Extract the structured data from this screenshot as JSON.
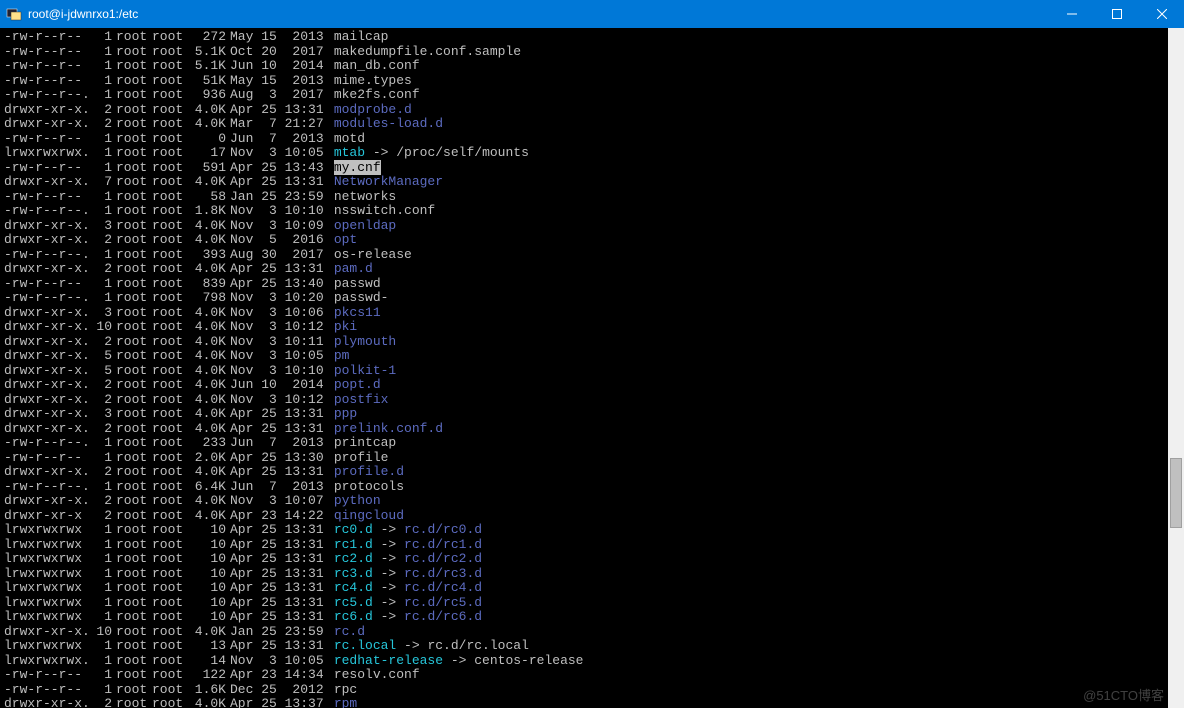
{
  "window": {
    "title": "root@i-jdwnrxo1:/etc"
  },
  "watermark": "@51CTO博客",
  "listing": [
    {
      "perm": "-rw-r--r--",
      "nl": "1",
      "own": "root",
      "grp": "root",
      "sz": "272",
      "date": "May 15  2013",
      "name": "mailcap",
      "type": "file"
    },
    {
      "perm": "-rw-r--r--",
      "nl": "1",
      "own": "root",
      "grp": "root",
      "sz": "5.1K",
      "date": "Oct 20  2017",
      "name": "makedumpfile.conf.sample",
      "type": "file"
    },
    {
      "perm": "-rw-r--r--",
      "nl": "1",
      "own": "root",
      "grp": "root",
      "sz": "5.1K",
      "date": "Jun 10  2014",
      "name": "man_db.conf",
      "type": "file"
    },
    {
      "perm": "-rw-r--r--",
      "nl": "1",
      "own": "root",
      "grp": "root",
      "sz": "51K",
      "date": "May 15  2013",
      "name": "mime.types",
      "type": "file"
    },
    {
      "perm": "-rw-r--r--.",
      "nl": "1",
      "own": "root",
      "grp": "root",
      "sz": "936",
      "date": "Aug  3  2017",
      "name": "mke2fs.conf",
      "type": "file"
    },
    {
      "perm": "drwxr-xr-x.",
      "nl": "2",
      "own": "root",
      "grp": "root",
      "sz": "4.0K",
      "date": "Apr 25 13:31",
      "name": "modprobe.d",
      "type": "dir"
    },
    {
      "perm": "drwxr-xr-x.",
      "nl": "2",
      "own": "root",
      "grp": "root",
      "sz": "4.0K",
      "date": "Mar  7 21:27",
      "name": "modules-load.d",
      "type": "dir"
    },
    {
      "perm": "-rw-r--r--",
      "nl": "1",
      "own": "root",
      "grp": "root",
      "sz": "0",
      "date": "Jun  7  2013",
      "name": "motd",
      "type": "file"
    },
    {
      "perm": "lrwxrwxrwx.",
      "nl": "1",
      "own": "root",
      "grp": "root",
      "sz": "17",
      "date": "Nov  3 10:05",
      "name": "mtab",
      "type": "link",
      "target": "/proc/self/mounts",
      "target_type": "plain"
    },
    {
      "perm": "-rw-r--r--",
      "nl": "1",
      "own": "root",
      "grp": "root",
      "sz": "591",
      "date": "Apr 25 13:43",
      "name": "my.cnf",
      "type": "highlight"
    },
    {
      "perm": "drwxr-xr-x.",
      "nl": "7",
      "own": "root",
      "grp": "root",
      "sz": "4.0K",
      "date": "Apr 25 13:31",
      "name": "NetworkManager",
      "type": "dir"
    },
    {
      "perm": "-rw-r--r--",
      "nl": "1",
      "own": "root",
      "grp": "root",
      "sz": "58",
      "date": "Jan 25 23:59",
      "name": "networks",
      "type": "file"
    },
    {
      "perm": "-rw-r--r--.",
      "nl": "1",
      "own": "root",
      "grp": "root",
      "sz": "1.8K",
      "date": "Nov  3 10:10",
      "name": "nsswitch.conf",
      "type": "file"
    },
    {
      "perm": "drwxr-xr-x.",
      "nl": "3",
      "own": "root",
      "grp": "root",
      "sz": "4.0K",
      "date": "Nov  3 10:09",
      "name": "openldap",
      "type": "dir"
    },
    {
      "perm": "drwxr-xr-x.",
      "nl": "2",
      "own": "root",
      "grp": "root",
      "sz": "4.0K",
      "date": "Nov  5  2016",
      "name": "opt",
      "type": "dir"
    },
    {
      "perm": "-rw-r--r--.",
      "nl": "1",
      "own": "root",
      "grp": "root",
      "sz": "393",
      "date": "Aug 30  2017",
      "name": "os-release",
      "type": "file"
    },
    {
      "perm": "drwxr-xr-x.",
      "nl": "2",
      "own": "root",
      "grp": "root",
      "sz": "4.0K",
      "date": "Apr 25 13:31",
      "name": "pam.d",
      "type": "dir"
    },
    {
      "perm": "-rw-r--r--",
      "nl": "1",
      "own": "root",
      "grp": "root",
      "sz": "839",
      "date": "Apr 25 13:40",
      "name": "passwd",
      "type": "file"
    },
    {
      "perm": "-rw-r--r--.",
      "nl": "1",
      "own": "root",
      "grp": "root",
      "sz": "798",
      "date": "Nov  3 10:20",
      "name": "passwd-",
      "type": "file"
    },
    {
      "perm": "drwxr-xr-x.",
      "nl": "3",
      "own": "root",
      "grp": "root",
      "sz": "4.0K",
      "date": "Nov  3 10:06",
      "name": "pkcs11",
      "type": "dir"
    },
    {
      "perm": "drwxr-xr-x.",
      "nl": "10",
      "own": "root",
      "grp": "root",
      "sz": "4.0K",
      "date": "Nov  3 10:12",
      "name": "pki",
      "type": "dir"
    },
    {
      "perm": "drwxr-xr-x.",
      "nl": "2",
      "own": "root",
      "grp": "root",
      "sz": "4.0K",
      "date": "Nov  3 10:11",
      "name": "plymouth",
      "type": "dir"
    },
    {
      "perm": "drwxr-xr-x.",
      "nl": "5",
      "own": "root",
      "grp": "root",
      "sz": "4.0K",
      "date": "Nov  3 10:05",
      "name": "pm",
      "type": "dir"
    },
    {
      "perm": "drwxr-xr-x.",
      "nl": "5",
      "own": "root",
      "grp": "root",
      "sz": "4.0K",
      "date": "Nov  3 10:10",
      "name": "polkit-1",
      "type": "dir"
    },
    {
      "perm": "drwxr-xr-x.",
      "nl": "2",
      "own": "root",
      "grp": "root",
      "sz": "4.0K",
      "date": "Jun 10  2014",
      "name": "popt.d",
      "type": "dir"
    },
    {
      "perm": "drwxr-xr-x.",
      "nl": "2",
      "own": "root",
      "grp": "root",
      "sz": "4.0K",
      "date": "Nov  3 10:12",
      "name": "postfix",
      "type": "dir"
    },
    {
      "perm": "drwxr-xr-x.",
      "nl": "3",
      "own": "root",
      "grp": "root",
      "sz": "4.0K",
      "date": "Apr 25 13:31",
      "name": "ppp",
      "type": "dir"
    },
    {
      "perm": "drwxr-xr-x.",
      "nl": "2",
      "own": "root",
      "grp": "root",
      "sz": "4.0K",
      "date": "Apr 25 13:31",
      "name": "prelink.conf.d",
      "type": "dir"
    },
    {
      "perm": "-rw-r--r--.",
      "nl": "1",
      "own": "root",
      "grp": "root",
      "sz": "233",
      "date": "Jun  7  2013",
      "name": "printcap",
      "type": "file"
    },
    {
      "perm": "-rw-r--r--",
      "nl": "1",
      "own": "root",
      "grp": "root",
      "sz": "2.0K",
      "date": "Apr 25 13:30",
      "name": "profile",
      "type": "file"
    },
    {
      "perm": "drwxr-xr-x.",
      "nl": "2",
      "own": "root",
      "grp": "root",
      "sz": "4.0K",
      "date": "Apr 25 13:31",
      "name": "profile.d",
      "type": "dir"
    },
    {
      "perm": "-rw-r--r--.",
      "nl": "1",
      "own": "root",
      "grp": "root",
      "sz": "6.4K",
      "date": "Jun  7  2013",
      "name": "protocols",
      "type": "file"
    },
    {
      "perm": "drwxr-xr-x.",
      "nl": "2",
      "own": "root",
      "grp": "root",
      "sz": "4.0K",
      "date": "Nov  3 10:07",
      "name": "python",
      "type": "dir"
    },
    {
      "perm": "drwxr-xr-x",
      "nl": "2",
      "own": "root",
      "grp": "root",
      "sz": "4.0K",
      "date": "Apr 23 14:22",
      "name": "qingcloud",
      "type": "dir"
    },
    {
      "perm": "lrwxrwxrwx",
      "nl": "1",
      "own": "root",
      "grp": "root",
      "sz": "10",
      "date": "Apr 25 13:31",
      "name": "rc0.d",
      "type": "link",
      "target": "rc.d/rc0.d",
      "target_type": "dir"
    },
    {
      "perm": "lrwxrwxrwx",
      "nl": "1",
      "own": "root",
      "grp": "root",
      "sz": "10",
      "date": "Apr 25 13:31",
      "name": "rc1.d",
      "type": "link",
      "target": "rc.d/rc1.d",
      "target_type": "dir"
    },
    {
      "perm": "lrwxrwxrwx",
      "nl": "1",
      "own": "root",
      "grp": "root",
      "sz": "10",
      "date": "Apr 25 13:31",
      "name": "rc2.d",
      "type": "link",
      "target": "rc.d/rc2.d",
      "target_type": "dir"
    },
    {
      "perm": "lrwxrwxrwx",
      "nl": "1",
      "own": "root",
      "grp": "root",
      "sz": "10",
      "date": "Apr 25 13:31",
      "name": "rc3.d",
      "type": "link",
      "target": "rc.d/rc3.d",
      "target_type": "dir"
    },
    {
      "perm": "lrwxrwxrwx",
      "nl": "1",
      "own": "root",
      "grp": "root",
      "sz": "10",
      "date": "Apr 25 13:31",
      "name": "rc4.d",
      "type": "link",
      "target": "rc.d/rc4.d",
      "target_type": "dir"
    },
    {
      "perm": "lrwxrwxrwx",
      "nl": "1",
      "own": "root",
      "grp": "root",
      "sz": "10",
      "date": "Apr 25 13:31",
      "name": "rc5.d",
      "type": "link",
      "target": "rc.d/rc5.d",
      "target_type": "dir"
    },
    {
      "perm": "lrwxrwxrwx",
      "nl": "1",
      "own": "root",
      "grp": "root",
      "sz": "10",
      "date": "Apr 25 13:31",
      "name": "rc6.d",
      "type": "link",
      "target": "rc.d/rc6.d",
      "target_type": "dir"
    },
    {
      "perm": "drwxr-xr-x.",
      "nl": "10",
      "own": "root",
      "grp": "root",
      "sz": "4.0K",
      "date": "Jan 25 23:59",
      "name": "rc.d",
      "type": "dir"
    },
    {
      "perm": "lrwxrwxrwx",
      "nl": "1",
      "own": "root",
      "grp": "root",
      "sz": "13",
      "date": "Apr 25 13:31",
      "name": "rc.local",
      "type": "link",
      "target": "rc.d/rc.local",
      "target_type": "plain"
    },
    {
      "perm": "lrwxrwxrwx.",
      "nl": "1",
      "own": "root",
      "grp": "root",
      "sz": "14",
      "date": "Nov  3 10:05",
      "name": "redhat-release",
      "type": "link",
      "target": "centos-release",
      "target_type": "plain"
    },
    {
      "perm": "-rw-r--r--",
      "nl": "1",
      "own": "root",
      "grp": "root",
      "sz": "122",
      "date": "Apr 23 14:34",
      "name": "resolv.conf",
      "type": "file"
    },
    {
      "perm": "-rw-r--r--",
      "nl": "1",
      "own": "root",
      "grp": "root",
      "sz": "1.6K",
      "date": "Dec 25  2012",
      "name": "rpc",
      "type": "file"
    },
    {
      "perm": "drwxr-xr-x.",
      "nl": "2",
      "own": "root",
      "grp": "root",
      "sz": "4.0K",
      "date": "Apr 25 13:37",
      "name": "rpm",
      "type": "dir"
    }
  ]
}
